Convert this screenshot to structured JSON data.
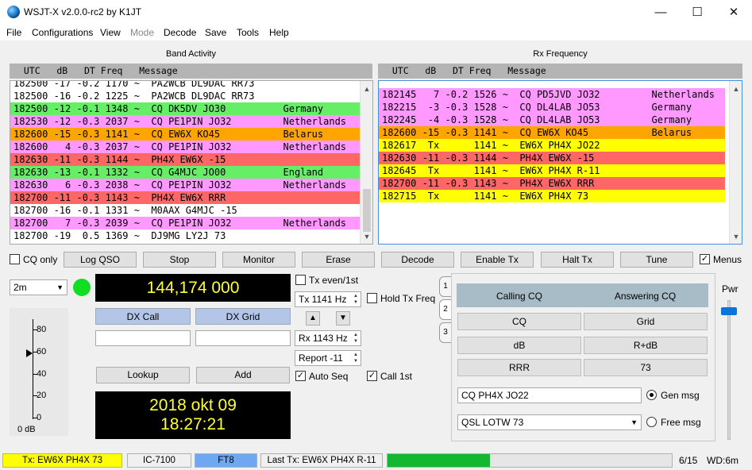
{
  "window": {
    "title": "WSJT-X   v2.0.0-rc2   by K1JT",
    "minimize": "—",
    "maximize": "☐",
    "close": "✕"
  },
  "menu": [
    "File",
    "Configurations",
    "View",
    "Mode",
    "Decode",
    "Save",
    "Tools",
    "Help"
  ],
  "band_activity": {
    "title": "Band Activity",
    "header": "  UTC   dB   DT Freq   Message",
    "rows": [
      {
        "text": "182500 -17 -0.2 1170 ~  PA2WCB DL9DAC RR73",
        "bg": "#ffffff"
      },
      {
        "text": "182500 -16 -0.2 1225 ~  PA2WCB DL9DAC RR73",
        "bg": "#ffffff"
      },
      {
        "text": "182500 -12 -0.1 1348 ~  CQ DK5DV JO30          Germany",
        "bg": "#66ee66"
      },
      {
        "text": "182530 -12 -0.3 2037 ~  CQ PE1PIN JO32         Netherlands",
        "bg": "#ff99ff"
      },
      {
        "text": "182600 -15 -0.3 1141 ~  CQ EW6X KO45           Belarus",
        "bg": "#ffa500"
      },
      {
        "text": "182600   4 -0.3 2037 ~  CQ PE1PIN JO32         Netherlands",
        "bg": "#ff99ff"
      },
      {
        "text": "182630 -11 -0.3 1144 ~  PH4X EW6X -15",
        "bg": "#ff6666"
      },
      {
        "text": "182630 -13 -0.1 1332 ~  CQ G4MJC JO00          England",
        "bg": "#66ee66"
      },
      {
        "text": "182630   6 -0.3 2038 ~  CQ PE1PIN JO32         Netherlands",
        "bg": "#ff99ff"
      },
      {
        "text": "182700 -11 -0.3 1143 ~  PH4X EW6X RRR",
        "bg": "#ff6666"
      },
      {
        "text": "182700 -16 -0.1 1331 ~  M0AAX G4MJC -15",
        "bg": "#ffffff"
      },
      {
        "text": "182700   7 -0.3 2039 ~  CQ PE1PIN JO32         Netherlands",
        "bg": "#ff99ff"
      },
      {
        "text": "182700 -19  0.5 1369 ~  DJ9MG LY2J 73",
        "bg": "#ffffff"
      }
    ]
  },
  "rx_frequency": {
    "title": "Rx Frequency",
    "header": "  UTC   dB   DT Freq   Message",
    "rows": [
      {
        "text": "182145   7 -0.2 1526 ~  CQ PD5JVD JO32         Netherlands",
        "bg": "#ff99ff"
      },
      {
        "text": "182215  -3 -0.3 1528 ~  CQ DL4LAB JO53         Germany",
        "bg": "#ff99ff"
      },
      {
        "text": "182245  -4 -0.3 1528 ~  CQ DL4LAB JO53         Germany",
        "bg": "#ff99ff"
      },
      {
        "text": "182600 -15 -0.3 1141 ~  CQ EW6X KO45           Belarus",
        "bg": "#ffa500"
      },
      {
        "text": "182617  Tx      1141 ~  EW6X PH4X JO22",
        "bg": "#ffff00"
      },
      {
        "text": "182630 -11 -0.3 1144 ~  PH4X EW6X -15",
        "bg": "#ff6666"
      },
      {
        "text": "182645  Tx      1141 ~  EW6X PH4X R-11",
        "bg": "#ffff00"
      },
      {
        "text": "182700 -11 -0.3 1143 ~  PH4X EW6X RRR",
        "bg": "#ff6666"
      },
      {
        "text": "182715  Tx      1141 ~  EW6X PH4X 73",
        "bg": "#ffff00"
      }
    ]
  },
  "controls": {
    "cq_only": "CQ only",
    "log_qso": "Log QSO",
    "stop": "Stop",
    "monitor": "Monitor",
    "erase": "Erase",
    "decode": "Decode",
    "enable_tx": "Enable Tx",
    "halt_tx": "Halt Tx",
    "tune": "Tune",
    "menus": "Menus"
  },
  "left": {
    "band": "2m",
    "frequency": "144,174 000",
    "dx_call_label": "DX Call",
    "dx_grid_label": "DX Grid",
    "lookup": "Lookup",
    "add": "Add",
    "date": "2018 okt 09",
    "time": "18:27:21",
    "meter_ticks": [
      "80",
      "60",
      "40",
      "20",
      "0"
    ],
    "meter_value_label": "0 dB"
  },
  "middle": {
    "tx_even": "Tx even/1st",
    "tx_freq": "Tx  1141  Hz",
    "hold_tx_freq": "Hold Tx Freq",
    "up_arrow": "▲",
    "down_arrow": "▼",
    "rx_freq": "Rx  1143  Hz",
    "report": "Report -11",
    "auto_seq": "Auto Seq",
    "call_1st": "Call 1st"
  },
  "tabs": [
    "1",
    "2",
    "3"
  ],
  "macros": {
    "calling_cq": "Calling CQ",
    "answering_cq": "Answering CQ",
    "cq": "CQ",
    "grid": "Grid",
    "db": "dB",
    "r_db": "R+dB",
    "rrr": "RRR",
    "seventy_three": "73",
    "gen_msg_value": "CQ PH4X JO22",
    "gen_msg_label": "Gen msg",
    "free_msg_value": "QSL LOTW 73",
    "free_msg_label": "Free msg"
  },
  "pwr_label": "Pwr",
  "status": {
    "tx": "Tx: EW6X PH4X 73",
    "rig": "IC-7100",
    "mode": "FT8",
    "last_tx": "Last Tx: EW6X PH4X R-11",
    "progress": 0.36,
    "period": "6/15",
    "wd": "WD:6m"
  },
  "colors": {
    "tx_yellow": "#ffff00",
    "mode_blue": "#6fa8f0",
    "progress_green": "#14b830",
    "lcd_yellow": "#ffff33"
  }
}
